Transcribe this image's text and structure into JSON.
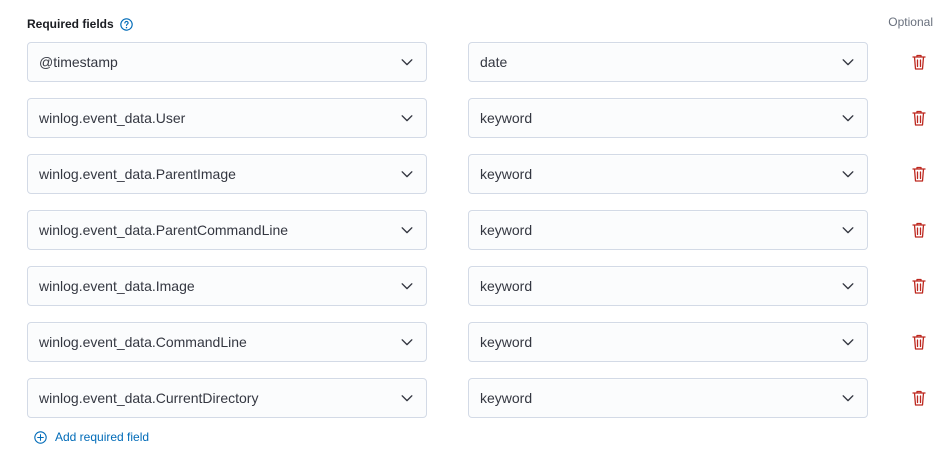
{
  "header": {
    "title": "Required fields",
    "optional_label": "Optional"
  },
  "rows": [
    {
      "field": "@timestamp",
      "type": "date"
    },
    {
      "field": "winlog.event_data.User",
      "type": "keyword"
    },
    {
      "field": "winlog.event_data.ParentImage",
      "type": "keyword"
    },
    {
      "field": "winlog.event_data.ParentCommandLine",
      "type": "keyword"
    },
    {
      "field": "winlog.event_data.Image",
      "type": "keyword"
    },
    {
      "field": "winlog.event_data.CommandLine",
      "type": "keyword"
    },
    {
      "field": "winlog.event_data.CurrentDirectory",
      "type": "keyword"
    }
  ],
  "add_link": {
    "label": "Add required field"
  },
  "colors": {
    "accent": "#006bb8",
    "danger": "#bd271e",
    "border": "#d3dae6"
  }
}
